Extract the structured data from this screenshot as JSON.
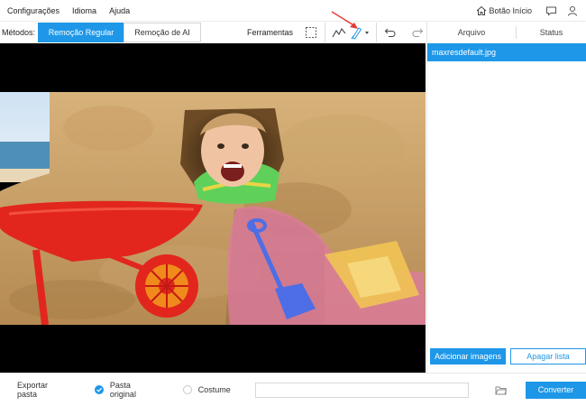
{
  "menu": {
    "items": [
      "Configurações",
      "Idioma",
      "Ajuda"
    ],
    "home_label": "Botão Início"
  },
  "toolbar": {
    "methods_label": "Métodos:",
    "regular_label": "Remoção Regular",
    "ai_label": "Remoção de AI",
    "tools_label": "Ferramentas"
  },
  "panel": {
    "col_file": "Arquivo",
    "col_status": "Status",
    "files": [
      "maxresdefault.jpg"
    ],
    "add_label": "Adicionar imagens",
    "clear_label": "Apagar lista"
  },
  "bottom": {
    "export_label": "Exportar pasta",
    "original_label": "Pasta original",
    "custom_label": "Costume",
    "path_value": "",
    "convert_label": "Converter"
  },
  "colors": {
    "accent": "#1e97e8",
    "annotation": "#e53935"
  }
}
